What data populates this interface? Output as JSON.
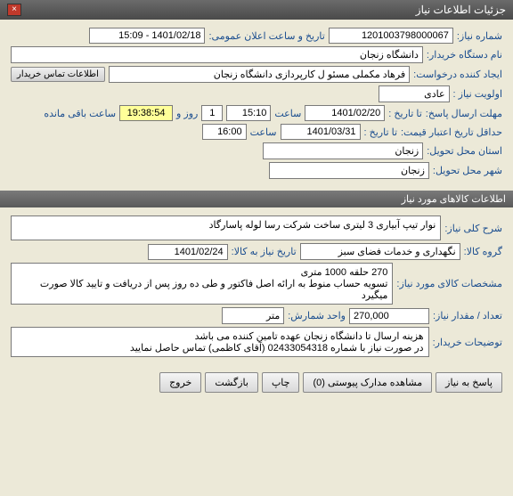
{
  "window": {
    "title": "جزئیات اطلاعات نیاز"
  },
  "need_info": {
    "need_no_label": "شماره نیاز:",
    "need_no": "1201003798000067",
    "public_datetime_label": "تاریخ و ساعت اعلان عمومی:",
    "public_datetime": "1401/02/18 - 15:09",
    "buyer_label": "نام دستگاه خریدار:",
    "buyer": "دانشگاه زنجان",
    "requester_label": "ایجاد کننده درخواست:",
    "requester": "فرهاد مکملی مسئو ل کارپردازی دانشگاه زنجان",
    "contact_btn": "اطلاعات تماس خریدار",
    "priority_label": "اولویت نیاز :",
    "priority": "عادی",
    "reply_deadline_label": "مهلت ارسال پاسخ:",
    "until_date_label": "تا تاریخ :",
    "until_date": "1401/02/20",
    "time_label": "ساعت",
    "until_time": "15:10",
    "countdown_days": "1",
    "days_and": "روز و",
    "countdown_time": "19:38:54",
    "remaining": "ساعت باقی مانده",
    "price_validity_label": "حداقل تاریخ اعتبار قیمت:",
    "price_until_date": "1401/03/31",
    "price_until_time": "16:00",
    "delivery_province_label": "استان محل تحویل:",
    "delivery_province": "زنجان",
    "delivery_city_label": "شهر محل تحویل:",
    "delivery_city": "زنجان"
  },
  "goods": {
    "section_title": "اطلاعات کالاهای مورد نیاز",
    "desc_label": "شرح کلی نیاز:",
    "desc": "نوار تیپ آبیاری 3 لیتری ساخت شرکت رسا لوله پاسارگاد",
    "group_label": "گروه کالا:",
    "group": "نگهداری و خدمات فضای سبز",
    "need_date_label": "تاریخ نیاز به کالا:",
    "need_date": "1401/02/24",
    "spec_label": "مشخصات کالای مورد نیاز:",
    "spec": "270 حلقه 1000 متری\nتسویه حساب منوط به ارائه اصل فاکتور و طی ده روز پس از دریافت و تایید کالا صورت میگیرد",
    "qty_label": "تعداد / مقدار نیاز:",
    "qty": "270,000",
    "unit_label": "واحد شمارش:",
    "unit": "متر",
    "buyer_notes_label": "توضیحات خریدار:",
    "buyer_notes": "هزینه ارسال تا دانشگاه زنجان عهده تامین کننده می باشد\nدر صورت نیاز با شماره 02433054318 (آقای کاظمی) تماس حاصل نمایید"
  },
  "footer": {
    "reply": "پاسخ به نیاز",
    "attachments": "مشاهده مدارک پیوستی (0)",
    "print": "چاپ",
    "back": "بازگشت",
    "exit": "خروج"
  }
}
